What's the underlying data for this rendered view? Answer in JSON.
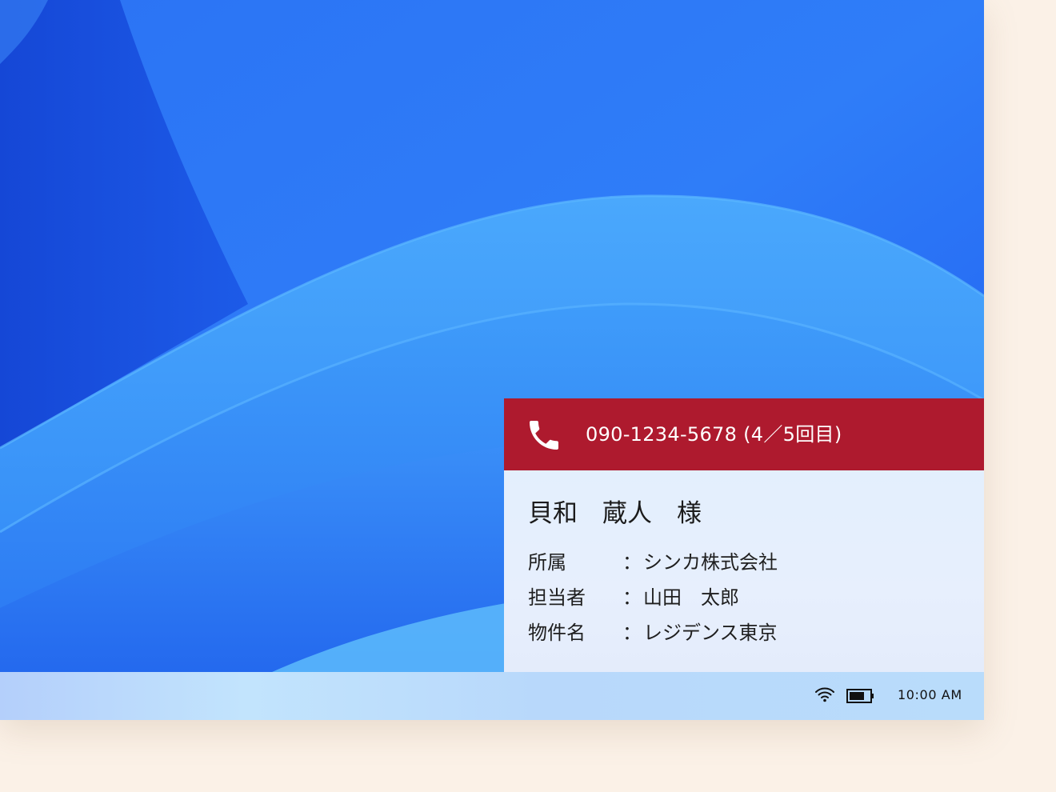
{
  "notification": {
    "phone_number": "090-1234-5678 (4／5回目)",
    "customer_name": "貝和　蔵人　様",
    "rows": [
      {
        "label": "所属",
        "colon": "：",
        "value": "シンカ株式会社"
      },
      {
        "label": "担当者",
        "colon": "：",
        "value": "山田　太郎"
      },
      {
        "label": "物件名",
        "colon": "：",
        "value": "レジデンス東京"
      }
    ],
    "header_color": "#ae1a2e",
    "icon": "phone-icon"
  },
  "taskbar": {
    "clock": "10:00 AM",
    "icons": [
      "wifi-icon",
      "battery-icon"
    ],
    "battery_level": 0.75
  },
  "colors": {
    "wallpaper_primary": "#2f7cf8",
    "wallpaper_dark": "#1a4fe0",
    "page_background": "#fbf1e7"
  }
}
